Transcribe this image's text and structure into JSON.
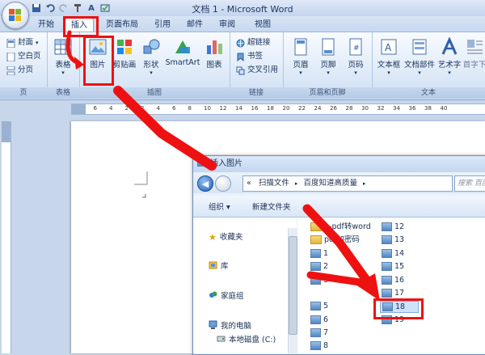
{
  "window": {
    "title": "文档 1 - Microsoft Word"
  },
  "quick_access": [
    "save-icon",
    "undo-icon",
    "redo-icon",
    "format-painter-icon",
    "spelling-icon",
    "abc-icon"
  ],
  "tabs": [
    "开始",
    "插入",
    "页面布局",
    "引用",
    "邮件",
    "审阅",
    "视图"
  ],
  "active_tab": "插入",
  "ribbon": {
    "pages": {
      "label": "页",
      "items": [
        "封面",
        "空白页",
        "分页"
      ]
    },
    "tables": {
      "label": "表格",
      "button": "表格"
    },
    "illustrations": {
      "label": "插图",
      "buttons": [
        "图片",
        "剪贴画",
        "形状",
        "SmartArt",
        "图表"
      ]
    },
    "links": {
      "label": "链接",
      "items": [
        "超链接",
        "书签",
        "交叉引用"
      ]
    },
    "header_footer": {
      "label": "页眉和页脚",
      "buttons": [
        "页眉",
        "页脚",
        "页码"
      ]
    },
    "text": {
      "label": "文本",
      "buttons": [
        "文本框",
        "文档部件",
        "艺术字",
        "首字下"
      ]
    }
  },
  "ruler": {
    "ticks": [
      "8",
      "6",
      "4",
      "2",
      "2",
      "4",
      "6",
      "8",
      "10",
      "12",
      "14",
      "16",
      "18",
      "20",
      "22",
      "24",
      "26",
      "28",
      "30",
      "32",
      "34",
      "36",
      "38",
      "40"
    ]
  },
  "dialog": {
    "title": "插入图片",
    "address": {
      "chevron": "«",
      "segments": [
        "扫描文件",
        "百度知道高质量"
      ],
      "separator": "▸"
    },
    "search_placeholder": "搜索 百度",
    "toolbar": {
      "organize": "组织 ▾",
      "new_folder": "新建文件夹"
    },
    "nav": [
      "收藏夹",
      "库",
      "家庭组",
      "我的电脑",
      "本地磁盘 (C:)"
    ],
    "files_col1": [
      "1-pdf转word",
      "pdf加密码",
      "1",
      "2",
      "3",
      "5",
      "6",
      "7",
      "8"
    ],
    "files_col2": [
      "12",
      "13",
      "14",
      "15",
      "16",
      "17",
      "18",
      "19"
    ],
    "selected_file": "18"
  },
  "colors": {
    "annotation": "#ee1111",
    "ribbon_bg": "#dfeaf8",
    "title_text": "#1d3660"
  }
}
